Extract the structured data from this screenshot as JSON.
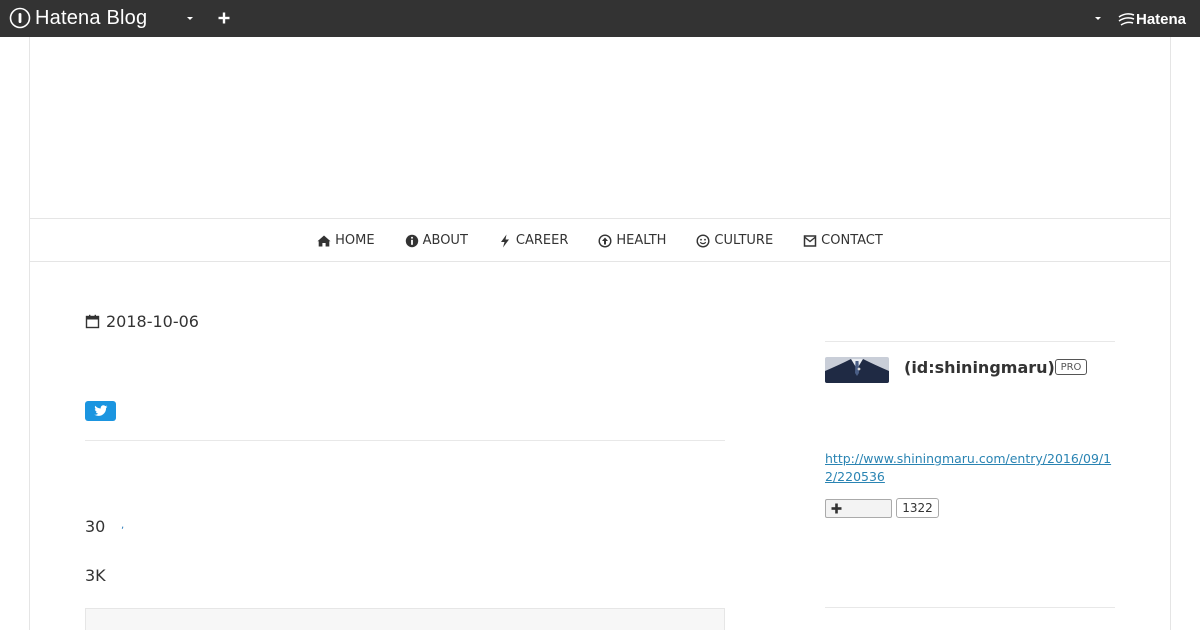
{
  "topbar": {
    "brand": "Hatena Blog",
    "hatena_label": "Hatena"
  },
  "nav": {
    "items": [
      {
        "label": "HOME",
        "icon": "home-icon"
      },
      {
        "label": "ABOUT",
        "icon": "info-icon"
      },
      {
        "label": "CAREER",
        "icon": "bolt-icon"
      },
      {
        "label": "HEALTH",
        "icon": "arrow-up-circle-icon"
      },
      {
        "label": "CULTURE",
        "icon": "smile-icon"
      },
      {
        "label": "CONTACT",
        "icon": "envelope-icon"
      }
    ]
  },
  "entry": {
    "date": "2018-10-06",
    "line1": "30",
    "line1_mark": ",",
    "line2": "3K"
  },
  "sidebar": {
    "profile_id": "(id:shiningmaru)",
    "pro_badge": "PRO",
    "link": "http://www.shiningmaru.com/entry/2016/09/12/220536",
    "bookmark_count": "1322"
  },
  "colors": {
    "topbar_bg": "#333333",
    "twitter_blue": "#1b95e0",
    "link_blue": "#2a84b3"
  }
}
